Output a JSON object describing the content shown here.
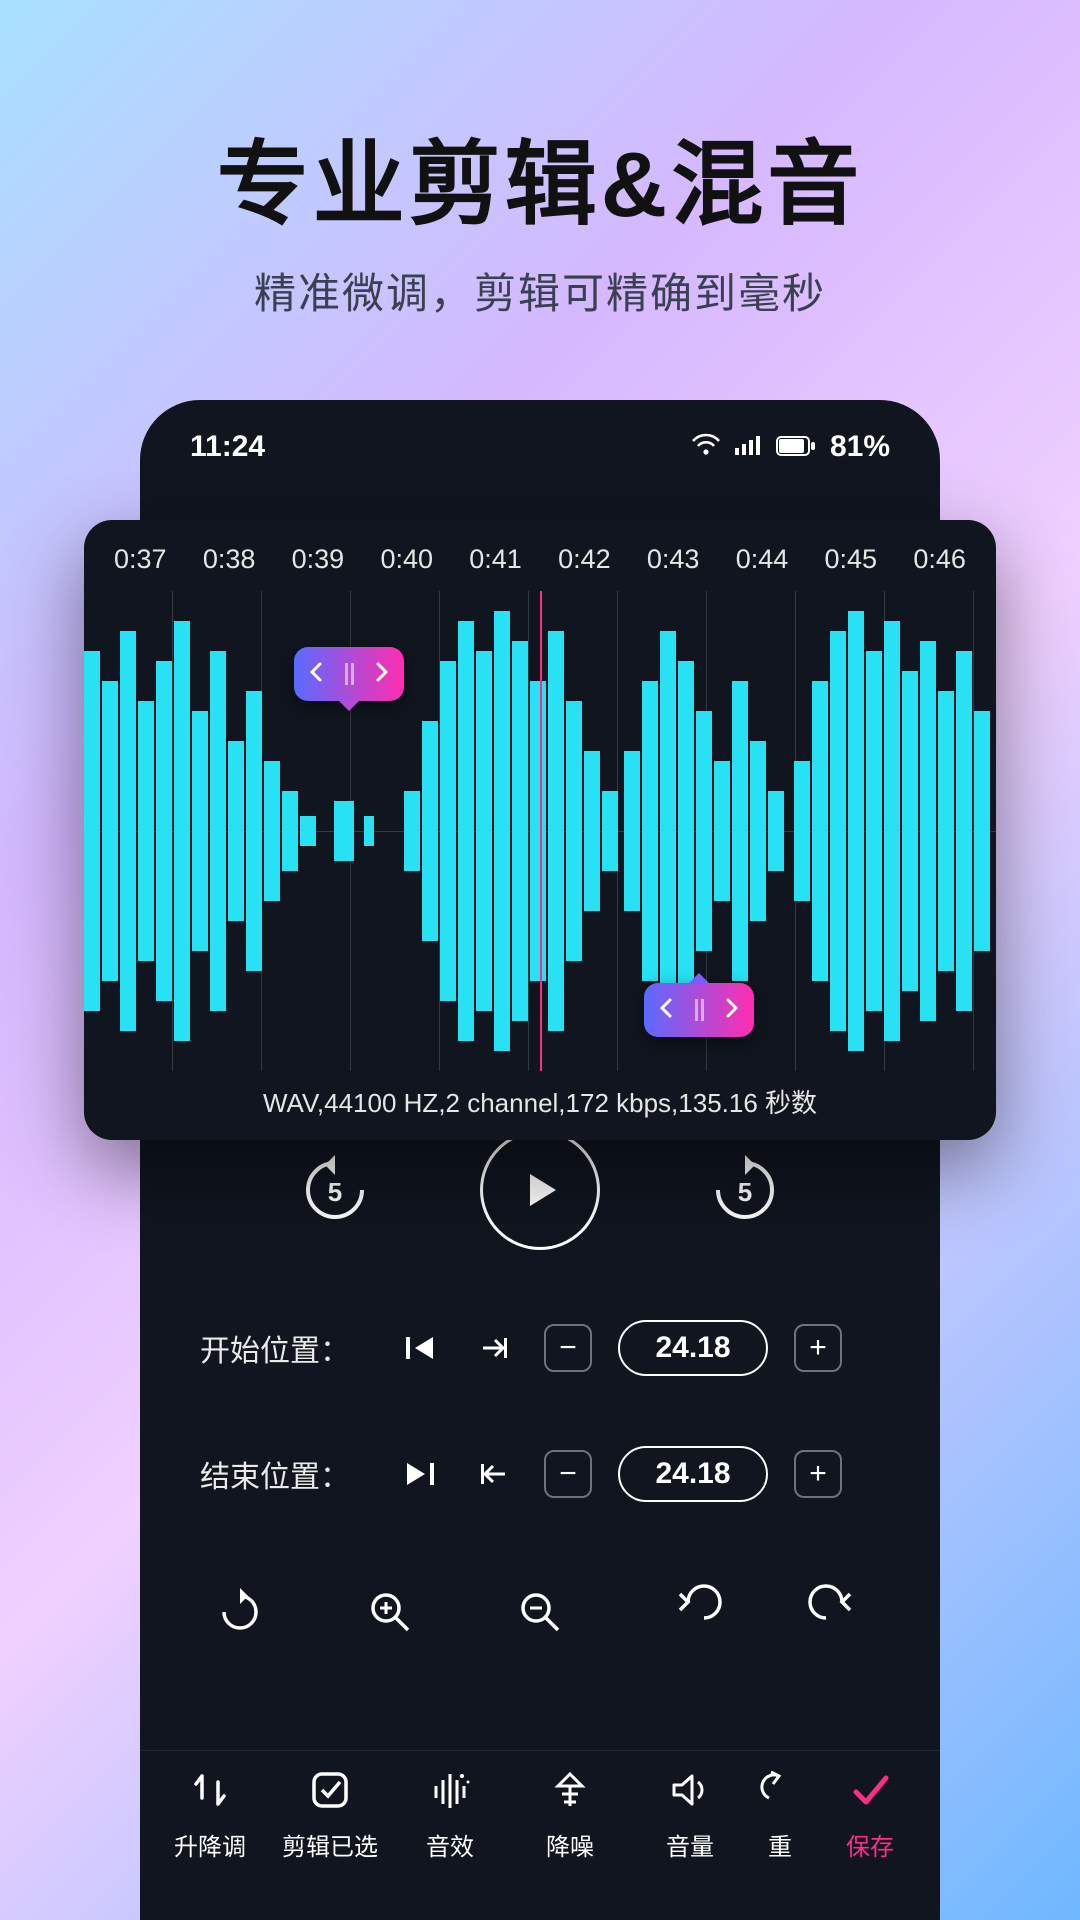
{
  "hero": {
    "title": "专业剪辑&混音",
    "subtitle": "精准微调，剪辑可精确到毫秒"
  },
  "statusbar": {
    "time": "11:24",
    "battery": "81%"
  },
  "waveform": {
    "ticks": [
      "0:37",
      "0:38",
      "0:39",
      "0:40",
      "0:41",
      "0:42",
      "0:43",
      "0:44",
      "0:45",
      "0:46"
    ],
    "meta": "WAV,44100 HZ,2 channel,172 kbps,135.16 秒数"
  },
  "transport": {
    "skip_back": "5",
    "skip_fwd": "5"
  },
  "positions": {
    "start_label": "开始位置：",
    "end_label": "结束位置：",
    "start_value": "24.18",
    "end_value": "24.18"
  },
  "tabs": {
    "pitch": "升降调",
    "trim": "剪辑已选",
    "fx": "音效",
    "denoise": "降噪",
    "volume": "音量",
    "repeat": "重",
    "save": "保存"
  },
  "colors": {
    "accent": "#ff2d87",
    "wave": "#28e1f2"
  }
}
